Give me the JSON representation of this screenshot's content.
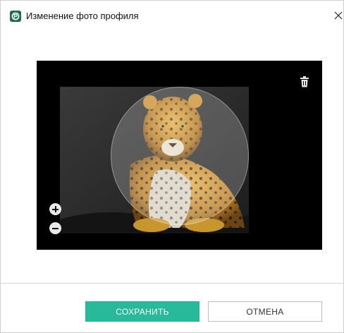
{
  "window": {
    "title": "Изменение фото профиля",
    "app_icon": "green-app-icon"
  },
  "titlebar": {
    "close_icon": "close-icon"
  },
  "editor": {
    "image_subject": "jaguar photo",
    "icons": {
      "delete": "trash-icon",
      "zoom_in": "zoom-in-icon",
      "zoom_out": "zoom-out-icon"
    }
  },
  "footer": {
    "save_label": "СОХРАНИТЬ",
    "cancel_label": "ОТМЕНА"
  },
  "colors": {
    "accent": "#28b89a",
    "stage_bg": "#000000",
    "app_icon": "#1f6e4a"
  }
}
